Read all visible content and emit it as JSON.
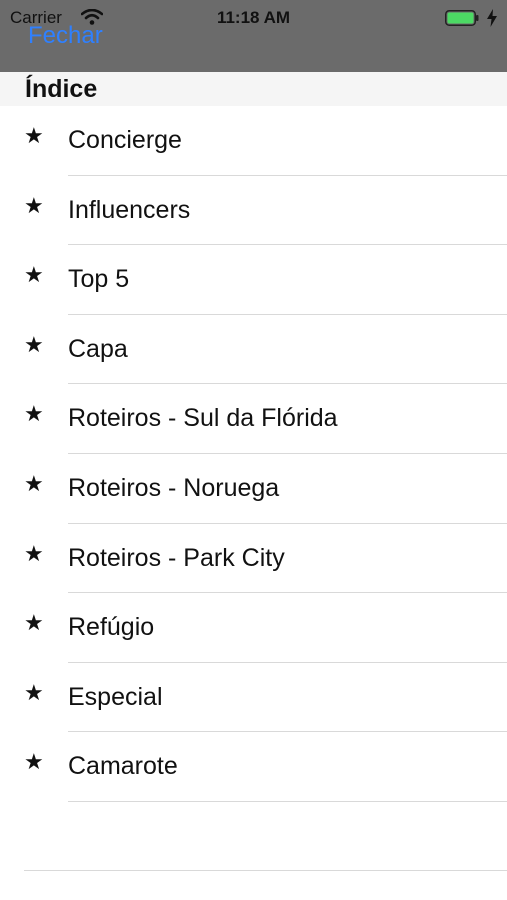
{
  "status": {
    "carrier": "Carrier",
    "time": "11:18 AM"
  },
  "nav": {
    "close_label": "Fechar"
  },
  "section": {
    "title": "Índice"
  },
  "items": [
    {
      "icon": "star",
      "label": "Concierge"
    },
    {
      "icon": "star",
      "label": "Influencers"
    },
    {
      "icon": "star",
      "label": "Top 5"
    },
    {
      "icon": "star",
      "label": "Capa"
    },
    {
      "icon": "star",
      "label": "Roteiros - Sul da Flórida"
    },
    {
      "icon": "star",
      "label": "Roteiros - Noruega"
    },
    {
      "icon": "star",
      "label": "Roteiros - Park City"
    },
    {
      "icon": "star",
      "label": "Refúgio"
    },
    {
      "icon": "star",
      "label": "Especial"
    },
    {
      "icon": "star",
      "label": "Camarote"
    }
  ],
  "colors": {
    "link": "#2f80ff",
    "bar": "#6b6b6b",
    "battery": "#4cd964"
  }
}
